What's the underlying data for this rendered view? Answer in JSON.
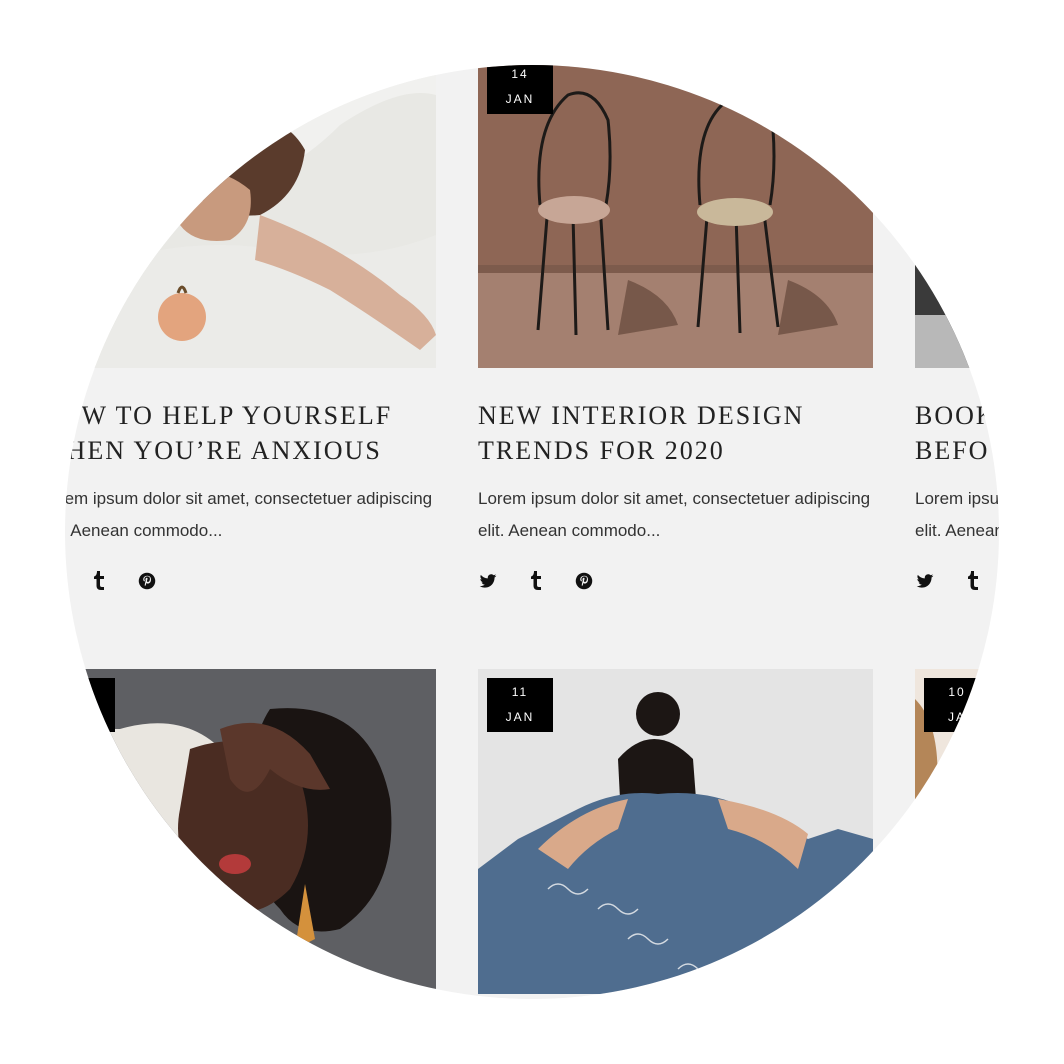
{
  "posts": [
    {
      "day": "",
      "month": "",
      "title_line1": "HOW TO HELP YOURSELF",
      "title_line2": "WHEN YOU’RE ANXIOUS",
      "excerpt": "Lorem ipsum dolor sit amet, consectetuer adipiscing elit. Aenean commodo...",
      "image": "woman-lying-on-bed-with-pear"
    },
    {
      "day": "14",
      "month": "JAN",
      "title_line1": "NEW INTERIOR DESIGN",
      "title_line2": "TRENDS FOR 2020",
      "excerpt": "Lorem ipsum dolor sit amet, consectetuer adipiscing elit. Aenean commodo...",
      "image": "two-wrought-iron-chairs"
    },
    {
      "day": "",
      "month": "",
      "title_line1": "BOOK",
      "title_line2": "BEFO",
      "excerpt": "Lorem ipsum dolor sit amet, consectetuer adipiscing elit. Aenean commodo...",
      "image": "partial-photo"
    },
    {
      "day": "",
      "month": "",
      "image": "woman-covering-eye-with-hand"
    },
    {
      "day": "11",
      "month": "JAN",
      "image": "woman-in-denim-jacket-from-behind"
    },
    {
      "day": "10",
      "month": "JA",
      "image": "partial-photo-hair"
    }
  ],
  "share_icons": [
    "twitter-icon",
    "tumblr-icon",
    "pinterest-icon"
  ],
  "colors": {
    "background": "#f2f2f2",
    "badge": "#000000",
    "text": "#222222"
  }
}
